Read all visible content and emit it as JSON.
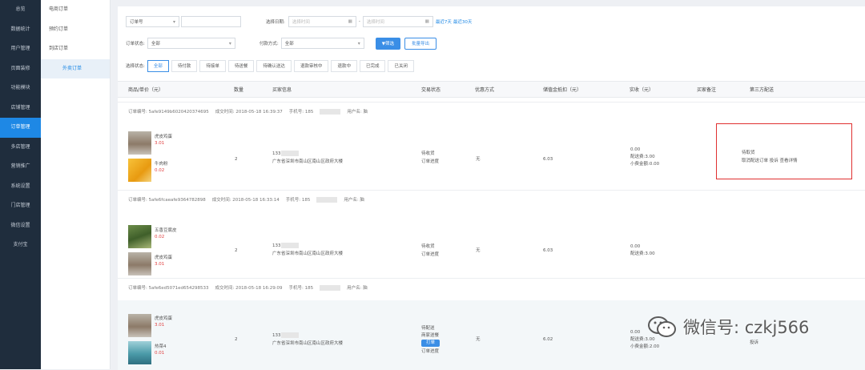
{
  "sidebar": {
    "items": [
      {
        "label": "总览"
      },
      {
        "label": "数据统计"
      },
      {
        "label": "用户管理"
      },
      {
        "label": "页面装修"
      },
      {
        "label": "功能模块"
      },
      {
        "label": "店铺管理"
      },
      {
        "label": "订单管理",
        "active": true
      },
      {
        "label": "多店管理"
      },
      {
        "label": "营销推广"
      },
      {
        "label": "系统设置"
      },
      {
        "label": "门店管理"
      },
      {
        "label": "微信设置"
      },
      {
        "label": "支付宝"
      }
    ]
  },
  "subnav": {
    "items": [
      {
        "label": "电商订单"
      },
      {
        "label": "预约订单"
      },
      {
        "label": "到店订单"
      },
      {
        "label": "外卖订单",
        "active": true
      }
    ]
  },
  "filters": {
    "search_type": "订单号",
    "search_value": "",
    "date_label": "选择日期:",
    "date_start_placeholder": "选择时间",
    "date_sep": "-",
    "date_end_placeholder": "选择时间",
    "recent7": "最近7天",
    "recent30": "最近30天",
    "status_label": "订单状态:",
    "status_value": "全部",
    "pay_label": "付款方式:",
    "pay_value": "全部",
    "filter_btn": "▼筛选",
    "export_btn": "批量导出",
    "select_status_label": "选择状态:",
    "tabs": [
      "全部",
      "待付款",
      "待接单",
      "待送餐",
      "待确认送达",
      "退款审核中",
      "退款中",
      "已完成",
      "已关闭"
    ]
  },
  "table": {
    "headers": [
      "商品/单价（元）",
      "数量",
      "买家信息",
      "交易状态",
      "优惠方式",
      "储值金抵扣（元）",
      "实收（元）",
      "买家备注",
      "第三方配送"
    ]
  },
  "orders": [
    {
      "no_label": "订单编号: 5afe9149b6020420374695",
      "time_label": "成交时间: 2018-05-18 16:39:37",
      "phone_label": "手机号: 185",
      "user_label": "用户名: 脑",
      "products": [
        {
          "name": "虎皮鸡蛋",
          "price": "3.01"
        },
        {
          "name": "牛肉粉",
          "price": "0.02"
        }
      ],
      "qty": "2",
      "buyer_phone": "133",
      "buyer_addr": "广东省深圳市南山区南山区政府大楼",
      "status": "待收货",
      "status_link": "订单进度",
      "discount": "无",
      "deduct": "6.03",
      "paid_line1": "0.00",
      "paid_line2": "配送费:3.00",
      "paid_line3": "小费金额:0.00",
      "third_status": "待取货",
      "third_actions": "取消配送订单 投诉 查看详情"
    },
    {
      "no_label": "订单编号: 5afe6fcaeafe9364782898",
      "time_label": "成交时间: 2018-05-18 16:33:14",
      "phone_label": "手机号: 185",
      "user_label": "用户名: 脑",
      "products": [
        {
          "name": "五香豆腐皮",
          "price": "0.02"
        },
        {
          "name": "虎皮鸡蛋",
          "price": "3.01"
        }
      ],
      "qty": "2",
      "buyer_phone": "133",
      "buyer_addr": "广东省深圳市南山区南山区政府大楼",
      "status": "待收货",
      "status_link": "订单进度",
      "discount": "无",
      "deduct": "6.03",
      "paid_line1": "0.00",
      "paid_line2": "配送费:3.00"
    },
    {
      "no_label": "订单编号: 5afe6ed5071ed654298533",
      "time_label": "成交时间: 2018-05-18 16:29:09",
      "phone_label": "手机号: 185",
      "user_label": "用户名: 脑",
      "products": [
        {
          "name": "虎皮鸡蛋",
          "price": "3.01"
        },
        {
          "name": "热菜4",
          "price": "0.01"
        }
      ],
      "qty": "2",
      "buyer_phone": "133",
      "buyer_addr": "广东省深圳市南山区南山区政府大楼",
      "status": "待配送",
      "status_link": "商家送餐",
      "print_btn": "打单",
      "status_link2": "订单进度",
      "discount": "无",
      "deduct": "6.02",
      "paid_line1": "0.00",
      "paid_line2": "配送费:3.00",
      "paid_line3": "小费金额:2.00",
      "third_actions": "投诉"
    }
  ],
  "watermark": {
    "text": "微信号: czkj566"
  },
  "colors": {
    "accent": "#1e88e5",
    "sidebar_bg": "#1f2d3d",
    "price_red": "#e04040",
    "highlight_box": "#e03030"
  }
}
